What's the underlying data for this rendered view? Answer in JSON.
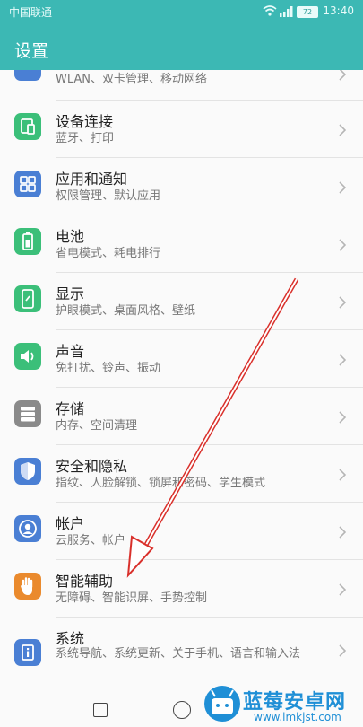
{
  "status": {
    "carrier": "中国联通",
    "battery": "72",
    "time": "13:40"
  },
  "header": {
    "title": "设置"
  },
  "rows": [
    {
      "label": "",
      "sub": "WLAN、双卡管理、移动网络",
      "icon": "network-icon",
      "color": "#4a7fd4"
    },
    {
      "label": "设备连接",
      "sub": "蓝牙、打印",
      "icon": "device-connection-icon",
      "color": "#3bbf79"
    },
    {
      "label": "应用和通知",
      "sub": "权限管理、默认应用",
      "icon": "apps-icon",
      "color": "#4a7fd4"
    },
    {
      "label": "电池",
      "sub": "省电模式、耗电排行",
      "icon": "battery-icon",
      "color": "#3bbf79"
    },
    {
      "label": "显示",
      "sub": "护眼模式、桌面风格、壁纸",
      "icon": "display-icon",
      "color": "#3bbf79"
    },
    {
      "label": "声音",
      "sub": "免打扰、铃声、振动",
      "icon": "sound-icon",
      "color": "#3bbf79"
    },
    {
      "label": "存储",
      "sub": "内存、空间清理",
      "icon": "storage-icon",
      "color": "#8a8a8a"
    },
    {
      "label": "安全和隐私",
      "sub": "指纹、人脸解锁、锁屏和密码、学生模式",
      "icon": "security-icon",
      "color": "#4a7fd4"
    },
    {
      "label": "帐户",
      "sub": "云服务、帐户",
      "icon": "account-icon",
      "color": "#4a7fd4"
    },
    {
      "label": "智能辅助",
      "sub": "无障碍、智能识屏、手势控制",
      "icon": "hand-icon",
      "color": "#ea8a2d"
    },
    {
      "label": "系统",
      "sub": "系统导航、系统更新、关于手机、语言和输入法",
      "icon": "system-icon",
      "color": "#4a7fd4"
    }
  ],
  "watermark": {
    "text": "蓝莓安卓网",
    "url": "www.lmkjst.com"
  },
  "colors": {
    "header": "#3cb8b4",
    "arrow": "#d9302b"
  }
}
